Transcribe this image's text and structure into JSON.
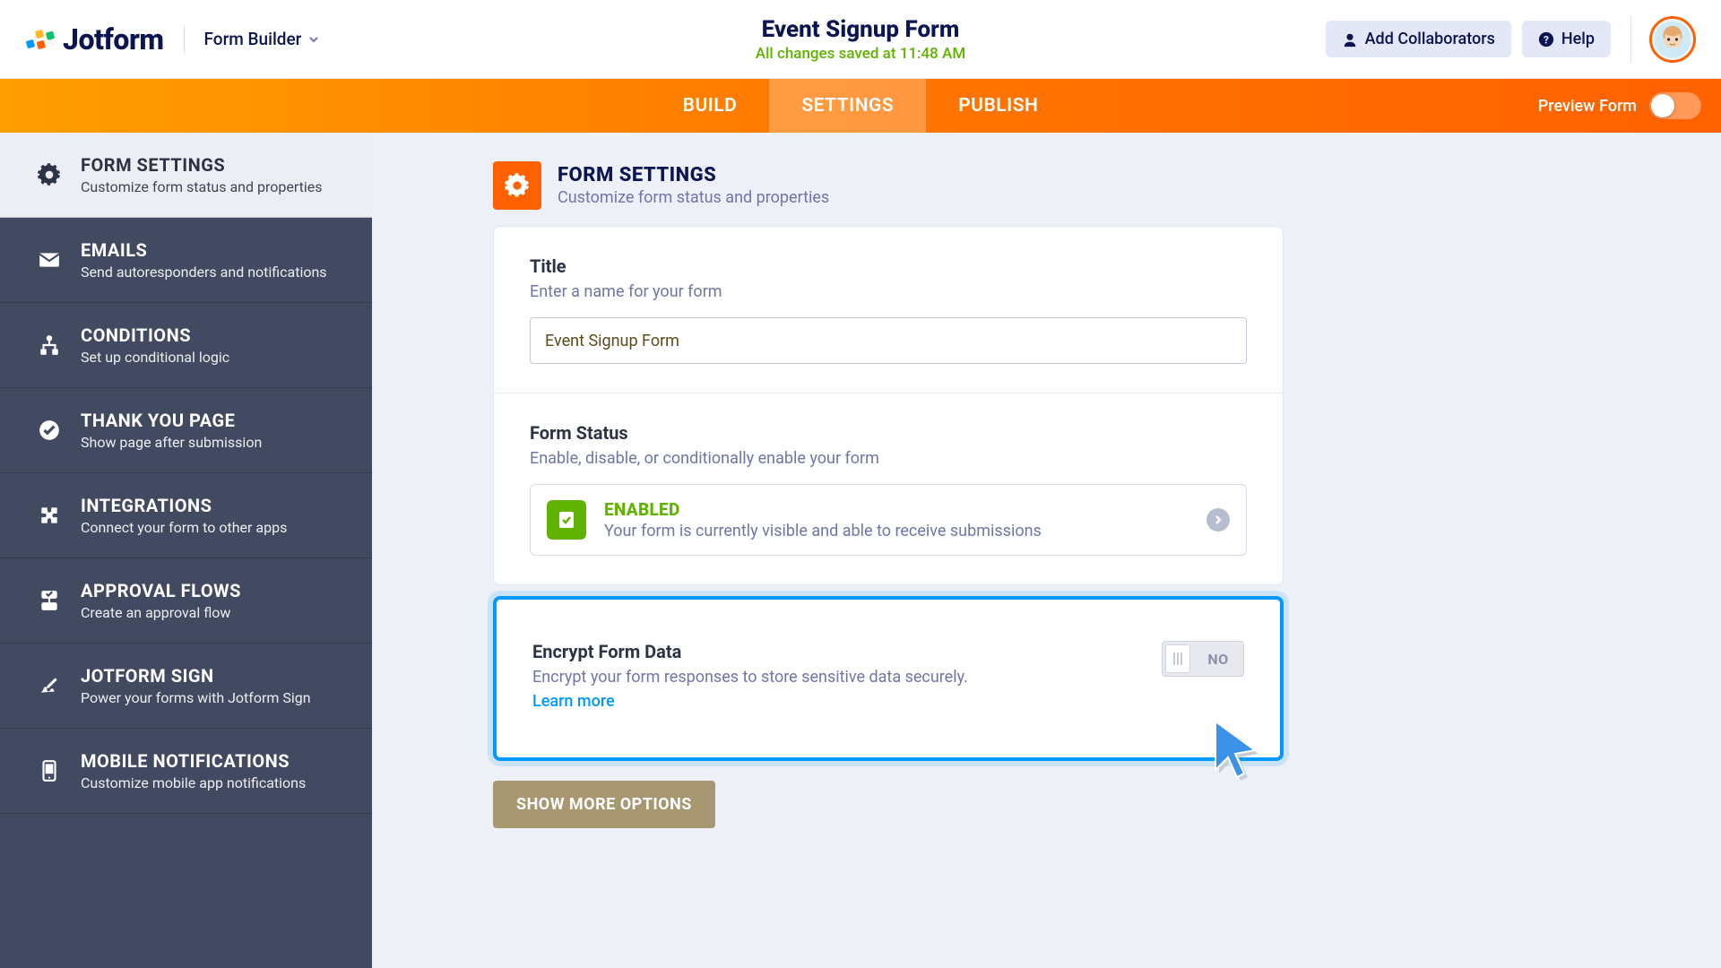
{
  "header": {
    "brand_name": "Jotform",
    "role": "Form Builder",
    "form_title": "Event Signup Form",
    "save_status": "All changes saved at 11:48 AM",
    "collaborators_btn": "Add Collaborators",
    "help_btn": "Help"
  },
  "nav": {
    "tabs": [
      "BUILD",
      "SETTINGS",
      "PUBLISH"
    ],
    "preview_label": "Preview Form"
  },
  "sidebar": {
    "items": [
      {
        "title": "FORM SETTINGS",
        "subtitle": "Customize form status and properties"
      },
      {
        "title": "EMAILS",
        "subtitle": "Send autoresponders and notifications"
      },
      {
        "title": "CONDITIONS",
        "subtitle": "Set up conditional logic"
      },
      {
        "title": "THANK YOU PAGE",
        "subtitle": "Show page after submission"
      },
      {
        "title": "INTEGRATIONS",
        "subtitle": "Connect your form to other apps"
      },
      {
        "title": "APPROVAL FLOWS",
        "subtitle": "Create an approval flow"
      },
      {
        "title": "JOTFORM SIGN",
        "subtitle": "Power your forms with Jotform Sign"
      },
      {
        "title": "MOBILE NOTIFICATIONS",
        "subtitle": "Customize mobile app notifications"
      }
    ]
  },
  "page": {
    "title": "FORM SETTINGS",
    "subtitle": "Customize form status and properties",
    "title_field": {
      "label": "Title",
      "sub": "Enter a name for your form",
      "value": "Event Signup Form"
    },
    "status_field": {
      "label": "Form Status",
      "sub": "Enable, disable, or conditionally enable your form",
      "value": "ENABLED",
      "value_sub": "Your form is currently visible and able to receive submissions"
    },
    "encrypt_field": {
      "label": "Encrypt Form Data",
      "sub": "Encrypt your form responses to store sensitive data securely.",
      "learn_more": "Learn more",
      "toggle_label": "NO"
    },
    "show_more": "SHOW MORE OPTIONS"
  }
}
